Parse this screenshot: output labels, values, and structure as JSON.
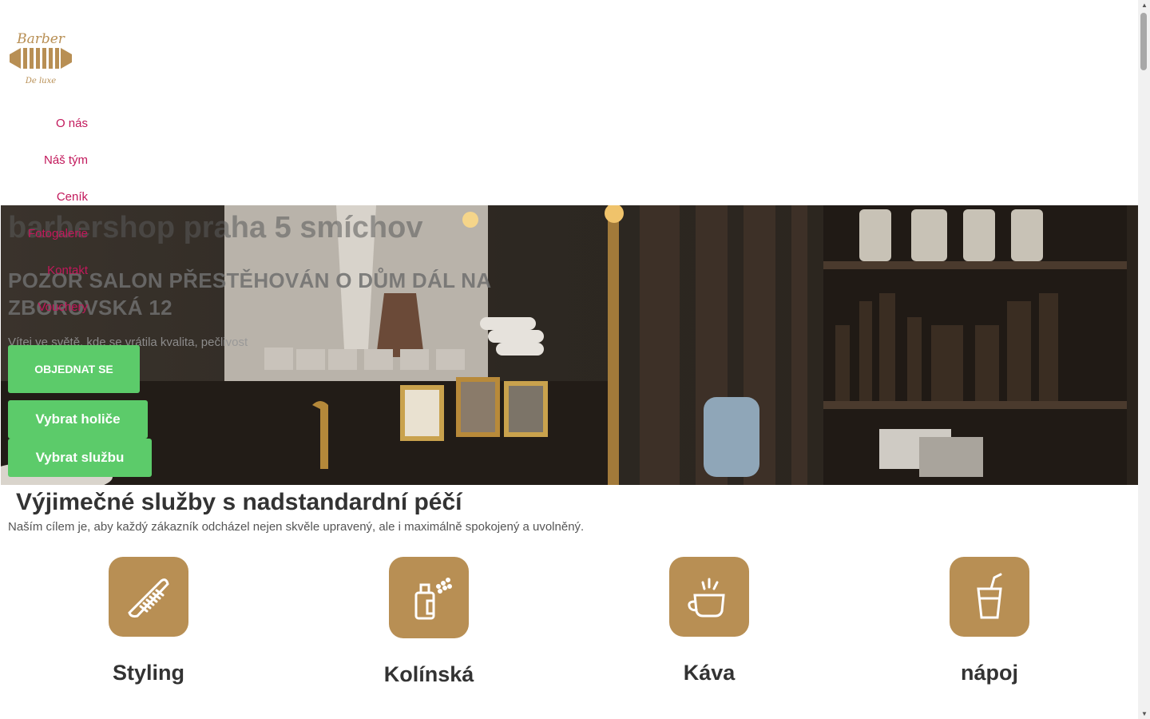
{
  "brand": {
    "logo_text_top": "Barber",
    "logo_text_bottom": "De luxe"
  },
  "nav": {
    "items": [
      {
        "label": "O nás"
      },
      {
        "label": "Náš tým"
      },
      {
        "label": "Ceník"
      },
      {
        "label": "Fotogalerie"
      },
      {
        "label": "Kontakt"
      },
      {
        "label": "Vouchery"
      }
    ]
  },
  "hero": {
    "title": "barbershop praha 5 smíchov",
    "notice": "POZOR SALON PŘESTĚHOVÁN O DŮM DÁL NA ZBOROVSKÁ 12",
    "tagline": "Vítej ve světě, kde se vrátila kvalita, pečlivost",
    "book_label": "OBJEDNAT SE",
    "choose_barber_label": "Vybrat holiče",
    "choose_service_label": "Vybrat službu"
  },
  "services": {
    "heading": "Výjimečné služby s nadstandardní péčí",
    "subheading": "Naším cílem je, aby každý zákazník odcházel nejen skvěle upravený, ale i maximálně spokojený a uvolněný.",
    "items": [
      {
        "label": "Styling",
        "icon": "comb-icon"
      },
      {
        "label": "Kolínská",
        "icon": "cologne-icon"
      },
      {
        "label": "Káva",
        "icon": "coffee-cup-icon"
      },
      {
        "label": "nápoj",
        "icon": "drink-glass-icon"
      }
    ]
  },
  "colors": {
    "accent": "#b88f54",
    "nav_link": "#c2185b",
    "button": "#5ccb6a"
  }
}
